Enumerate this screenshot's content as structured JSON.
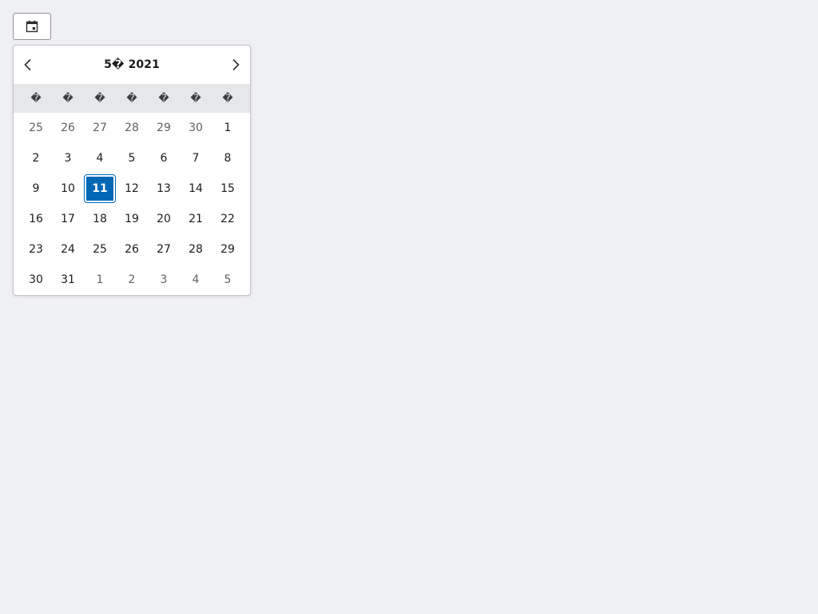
{
  "trigger": {
    "icon": "calendar-icon"
  },
  "calendar": {
    "title": "5� 2021",
    "prev_icon": "chevron-left-icon",
    "next_icon": "chevron-right-icon",
    "weekdays": [
      "�",
      "�",
      "�",
      "�",
      "�",
      "�",
      "�"
    ],
    "weeks": [
      [
        {
          "d": "25",
          "m": true
        },
        {
          "d": "26",
          "m": true
        },
        {
          "d": "27",
          "m": true
        },
        {
          "d": "28",
          "m": true
        },
        {
          "d": "29",
          "m": true
        },
        {
          "d": "30",
          "m": true
        },
        {
          "d": "1"
        }
      ],
      [
        {
          "d": "2"
        },
        {
          "d": "3"
        },
        {
          "d": "4"
        },
        {
          "d": "5"
        },
        {
          "d": "6"
        },
        {
          "d": "7"
        },
        {
          "d": "8"
        }
      ],
      [
        {
          "d": "9"
        },
        {
          "d": "10"
        },
        {
          "d": "11",
          "s": true
        },
        {
          "d": "12"
        },
        {
          "d": "13"
        },
        {
          "d": "14"
        },
        {
          "d": "15"
        }
      ],
      [
        {
          "d": "16"
        },
        {
          "d": "17"
        },
        {
          "d": "18"
        },
        {
          "d": "19"
        },
        {
          "d": "20"
        },
        {
          "d": "21"
        },
        {
          "d": "22"
        }
      ],
      [
        {
          "d": "23"
        },
        {
          "d": "24"
        },
        {
          "d": "25"
        },
        {
          "d": "26"
        },
        {
          "d": "27"
        },
        {
          "d": "28"
        },
        {
          "d": "29"
        }
      ],
      [
        {
          "d": "30"
        },
        {
          "d": "31"
        },
        {
          "d": "1",
          "m": true
        },
        {
          "d": "2",
          "m": true
        },
        {
          "d": "3",
          "m": true
        },
        {
          "d": "4",
          "m": true
        },
        {
          "d": "5",
          "m": true
        }
      ]
    ],
    "colors": {
      "accent": "#0068b5",
      "background": "#eff0f3"
    }
  }
}
